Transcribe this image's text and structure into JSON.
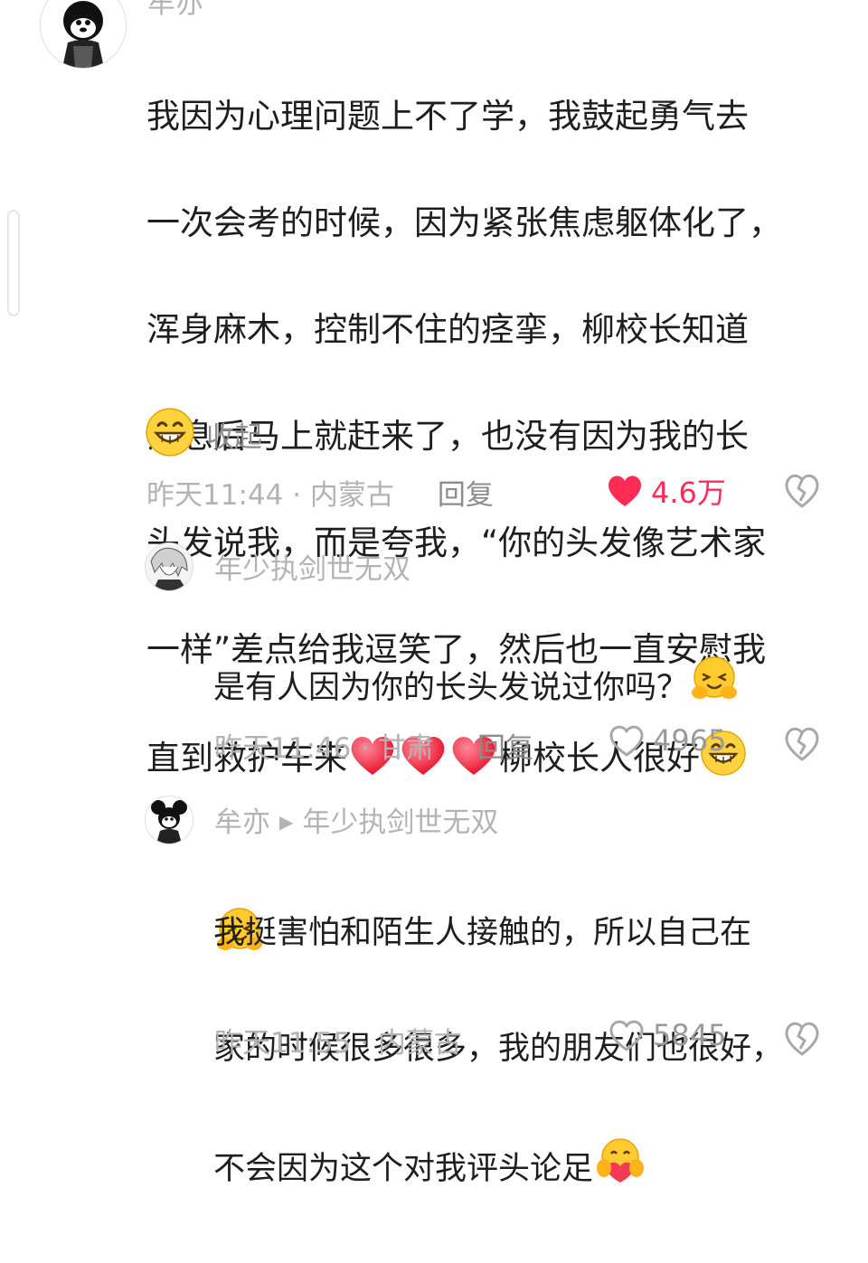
{
  "comments": [
    {
      "author": "牟亦",
      "text_lines": [
        "我因为心理问题上不了学，我鼓起勇气去",
        "一次会考的时候，因为紧张焦虑躯体化了，",
        "浑身麻木，控制不住的痉挛，柳校长知道",
        "消息后马上就赶来了，也没有因为我的长",
        "头发说我，而是夸我，“你的头发像艺术家",
        "一样”差点给我逗笑了，然后也一直安慰我"
      ],
      "line7_a": "直到救护车来",
      "line7_b": "柳校长人很好",
      "collapse_label": "收起",
      "time_location": "昨天11:44 · 内蒙古",
      "reply_label": "回复",
      "like_count": "4.6万",
      "liked": true
    },
    {
      "author": "年少执剑世无双",
      "text_line1": "是有人因为你的长头发说过你吗？",
      "time_location": "昨天11:46 · 甘肃",
      "reply_label": "回复",
      "like_count": "4965",
      "liked": false
    },
    {
      "author": "牟亦",
      "reply_to": "年少执剑世无双",
      "text_lines": [
        "我挺害怕和陌生人接触的，所以自己在",
        "家的时候很多很多，我的朋友们也很好，"
      ],
      "text_line3": "不会因为这个对我评头论足",
      "time_location": "昨天11:55 · 内蒙古",
      "like_count": "5845",
      "liked": false
    }
  ],
  "colors": {
    "like_active": "#fe2c55",
    "meta_gray": "#b3b3b3",
    "icon_gray": "#a8a8a8"
  },
  "icons": {
    "heart": "heart-icon",
    "broken_heart": "dislike-icon",
    "grin": "grinning-emoji",
    "hug": "hugging-emoji",
    "love_hug": "hug-heart-emoji",
    "red_heart": "red-heart-emoji"
  }
}
